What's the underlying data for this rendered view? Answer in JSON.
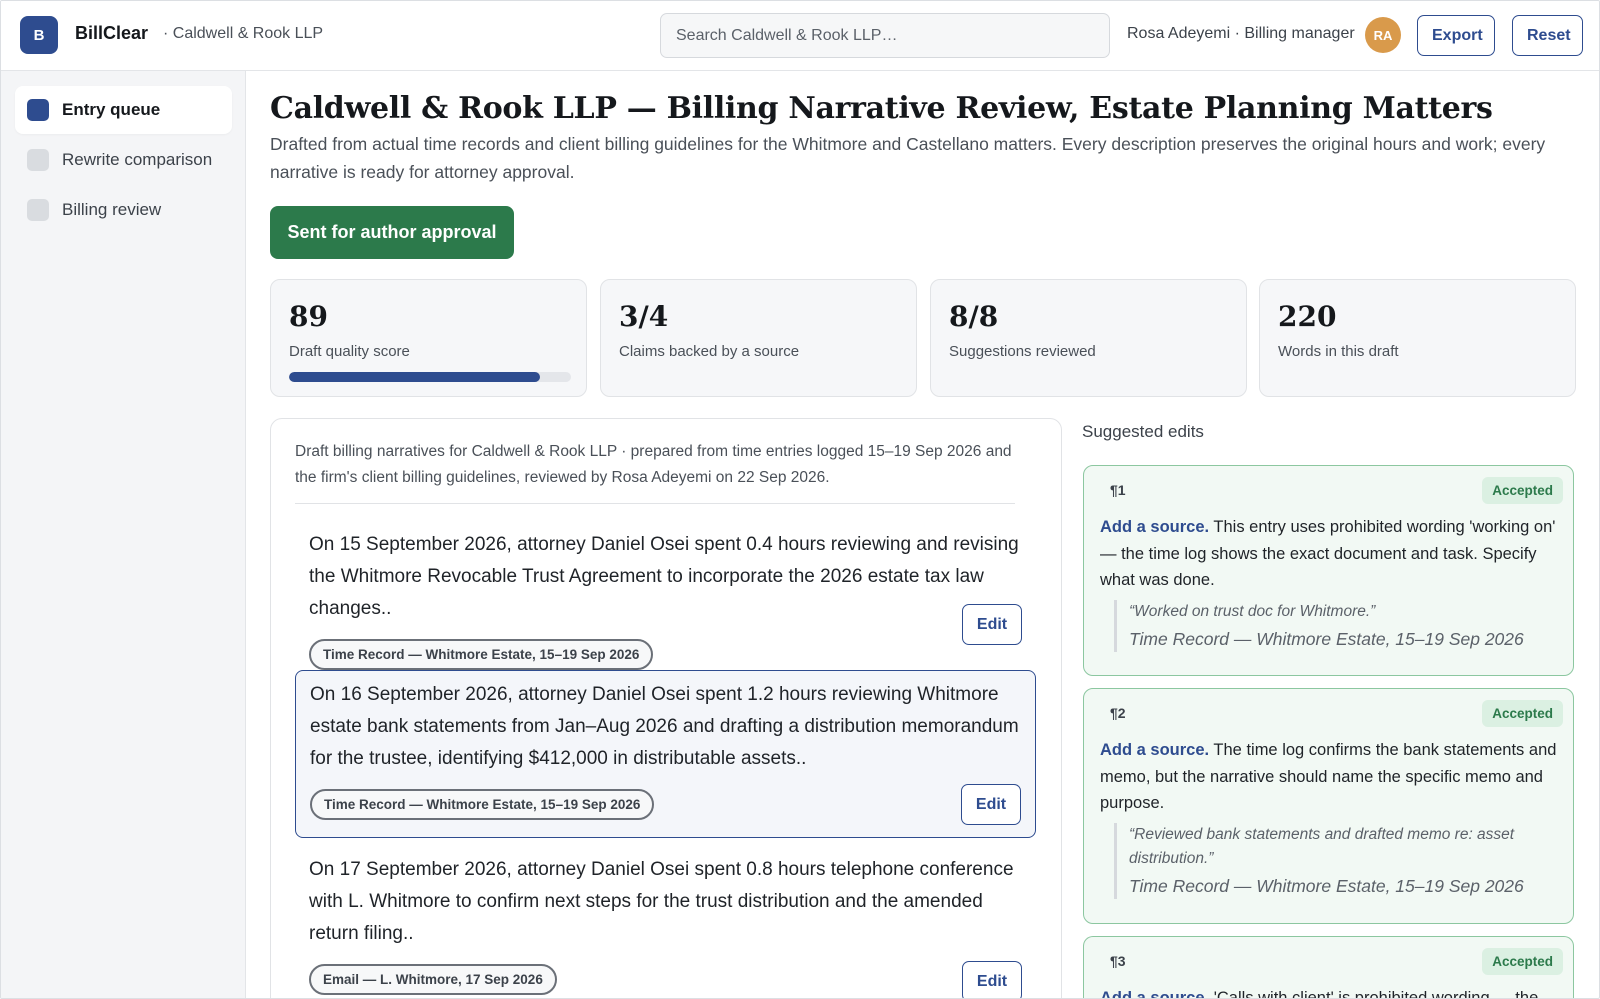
{
  "app": {
    "logo_letter": "B",
    "name": "BillClear",
    "client_sub": "· Caldwell & Rook LLP"
  },
  "header": {
    "search_placeholder": "Search Caldwell & Rook LLP…",
    "user": "Rosa Adeyemi · Billing manager",
    "avatar_initials": "RA",
    "export_label": "Export",
    "reset_label": "Reset"
  },
  "sidebar": {
    "items": [
      {
        "label": "Entry queue",
        "active": true
      },
      {
        "label": "Rewrite comparison",
        "active": false
      },
      {
        "label": "Billing review",
        "active": false
      }
    ]
  },
  "main": {
    "title": "Caldwell & Rook LLP — Billing Narrative Review, Estate Planning Matters",
    "description": "Drafted from actual time records and client billing guidelines for the Whitmore and Castellano matters. Every description preserves the original hours and work; every narrative is ready for attorney approval.",
    "approval_button": "Sent for author approval"
  },
  "stats": [
    {
      "value": "89",
      "label": "Draft quality score",
      "progress": 0.89
    },
    {
      "value": "3/4",
      "label": "Claims backed by a source"
    },
    {
      "value": "8/8",
      "label": "Suggestions reviewed"
    },
    {
      "value": "220",
      "label": "Words in this draft"
    }
  ],
  "draft": {
    "intro": "Draft billing narratives for Caldwell & Rook LLP · prepared from time entries logged 15–19 Sep 2026 and the firm's client billing guidelines, reviewed by Rosa Adeyemi on 22 Sep 2026.",
    "edit_label": "Edit",
    "entries": [
      {
        "text": "On 15 September 2026, attorney Daniel Osei spent 0.4 hours reviewing and revising the Whitmore Revocable Trust Agreement to incorporate the 2026 estate tax law changes..",
        "source": "Time Record — Whitmore Estate, 15–19 Sep 2026"
      },
      {
        "text": "On 16 September 2026, attorney Daniel Osei spent 1.2 hours reviewing Whitmore estate bank statements from Jan–Aug 2026 and drafting a distribution memorandum for the trustee, identifying $412,000 in distributable assets..",
        "source": "Time Record — Whitmore Estate, 15–19 Sep 2026"
      },
      {
        "text": "On 17 September 2026, attorney Daniel Osei spent 0.8 hours telephone conference with L. Whitmore to confirm next steps for the trust distribution and the amended return filing..",
        "source": "Email — L. Whitmore, 17 Sep 2026"
      }
    ]
  },
  "suggestions": {
    "heading": "Suggested edits",
    "items": [
      {
        "num": "¶1",
        "status": "Accepted",
        "action": "Add a source.",
        "body": "This entry uses prohibited wording 'working on' — the time log shows the exact document and task. Specify what was done.",
        "quote": "“Worked on trust doc for Whitmore.”",
        "source": "Time Record — Whitmore Estate, 15–19 Sep 2026"
      },
      {
        "num": "¶2",
        "status": "Accepted",
        "action": "Add a source.",
        "body": "The time log confirms the bank statements and memo, but the narrative should name the specific memo and purpose.",
        "quote": "“Reviewed bank statements and drafted memo re: asset distribution.”",
        "source": "Time Record — Whitmore Estate, 15–19 Sep 2026"
      },
      {
        "num": "¶3",
        "status": "Accepted",
        "action": "Add a source.",
        "body": "'Calls with client' is prohibited wording — the"
      }
    ]
  },
  "colors": {
    "accent": "#2e4c8f",
    "approve_green": "#2c7a4b",
    "accepted_border": "#8cc7a0",
    "avatar": "#d99a4b"
  }
}
